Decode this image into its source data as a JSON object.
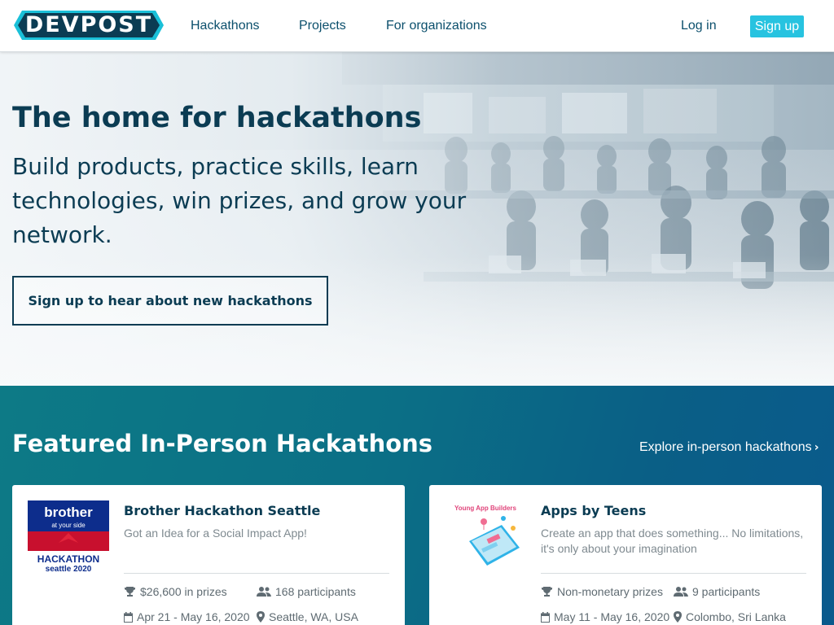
{
  "header": {
    "logo_text": "DEVPOST",
    "nav": [
      "Hackathons",
      "Projects",
      "For organizations"
    ],
    "login_label": "Log in",
    "signup_label": "Sign up"
  },
  "hero": {
    "title": "The home for hackathons",
    "subtitle": "Build products, practice skills, learn technologies, win prizes, and grow your network.",
    "cta_label": "Sign up to hear about new hackathons"
  },
  "featured": {
    "title": "Featured In-Person Hackathons",
    "explore_label": "Explore in-person hackathons",
    "cards": [
      {
        "title": "Brother Hackathon Seattle",
        "description": "Got an Idea for a Social Impact App!",
        "prizes": "$26,600 in prizes",
        "participants": "168 participants",
        "dates": "Apr 21 - May 16, 2020",
        "location": "Seattle, WA, USA",
        "thumb": {
          "brand": "brother",
          "tagline": "at your side",
          "event": "HACKATHON",
          "edition": "seattle 2020"
        }
      },
      {
        "title": "Apps by Teens",
        "description": "Create an app that does something... No limitations, it's only about your imagination",
        "prizes": "Non-monetary prizes",
        "participants": "9 participants",
        "dates": "May 11 - May 16, 2020",
        "location": "Colombo, Sri Lanka",
        "thumb": {
          "caption": "Young App Builders"
        }
      }
    ]
  },
  "icons": {
    "prizes": "trophy-icon",
    "participants": "users-icon",
    "dates": "calendar-icon",
    "location": "map-marker-icon"
  },
  "colors": {
    "brand_dark": "#0b3c53",
    "signup_button": "#27c3e0",
    "featured_bg": "#0b6f86",
    "text_muted": "#7f8a90"
  }
}
